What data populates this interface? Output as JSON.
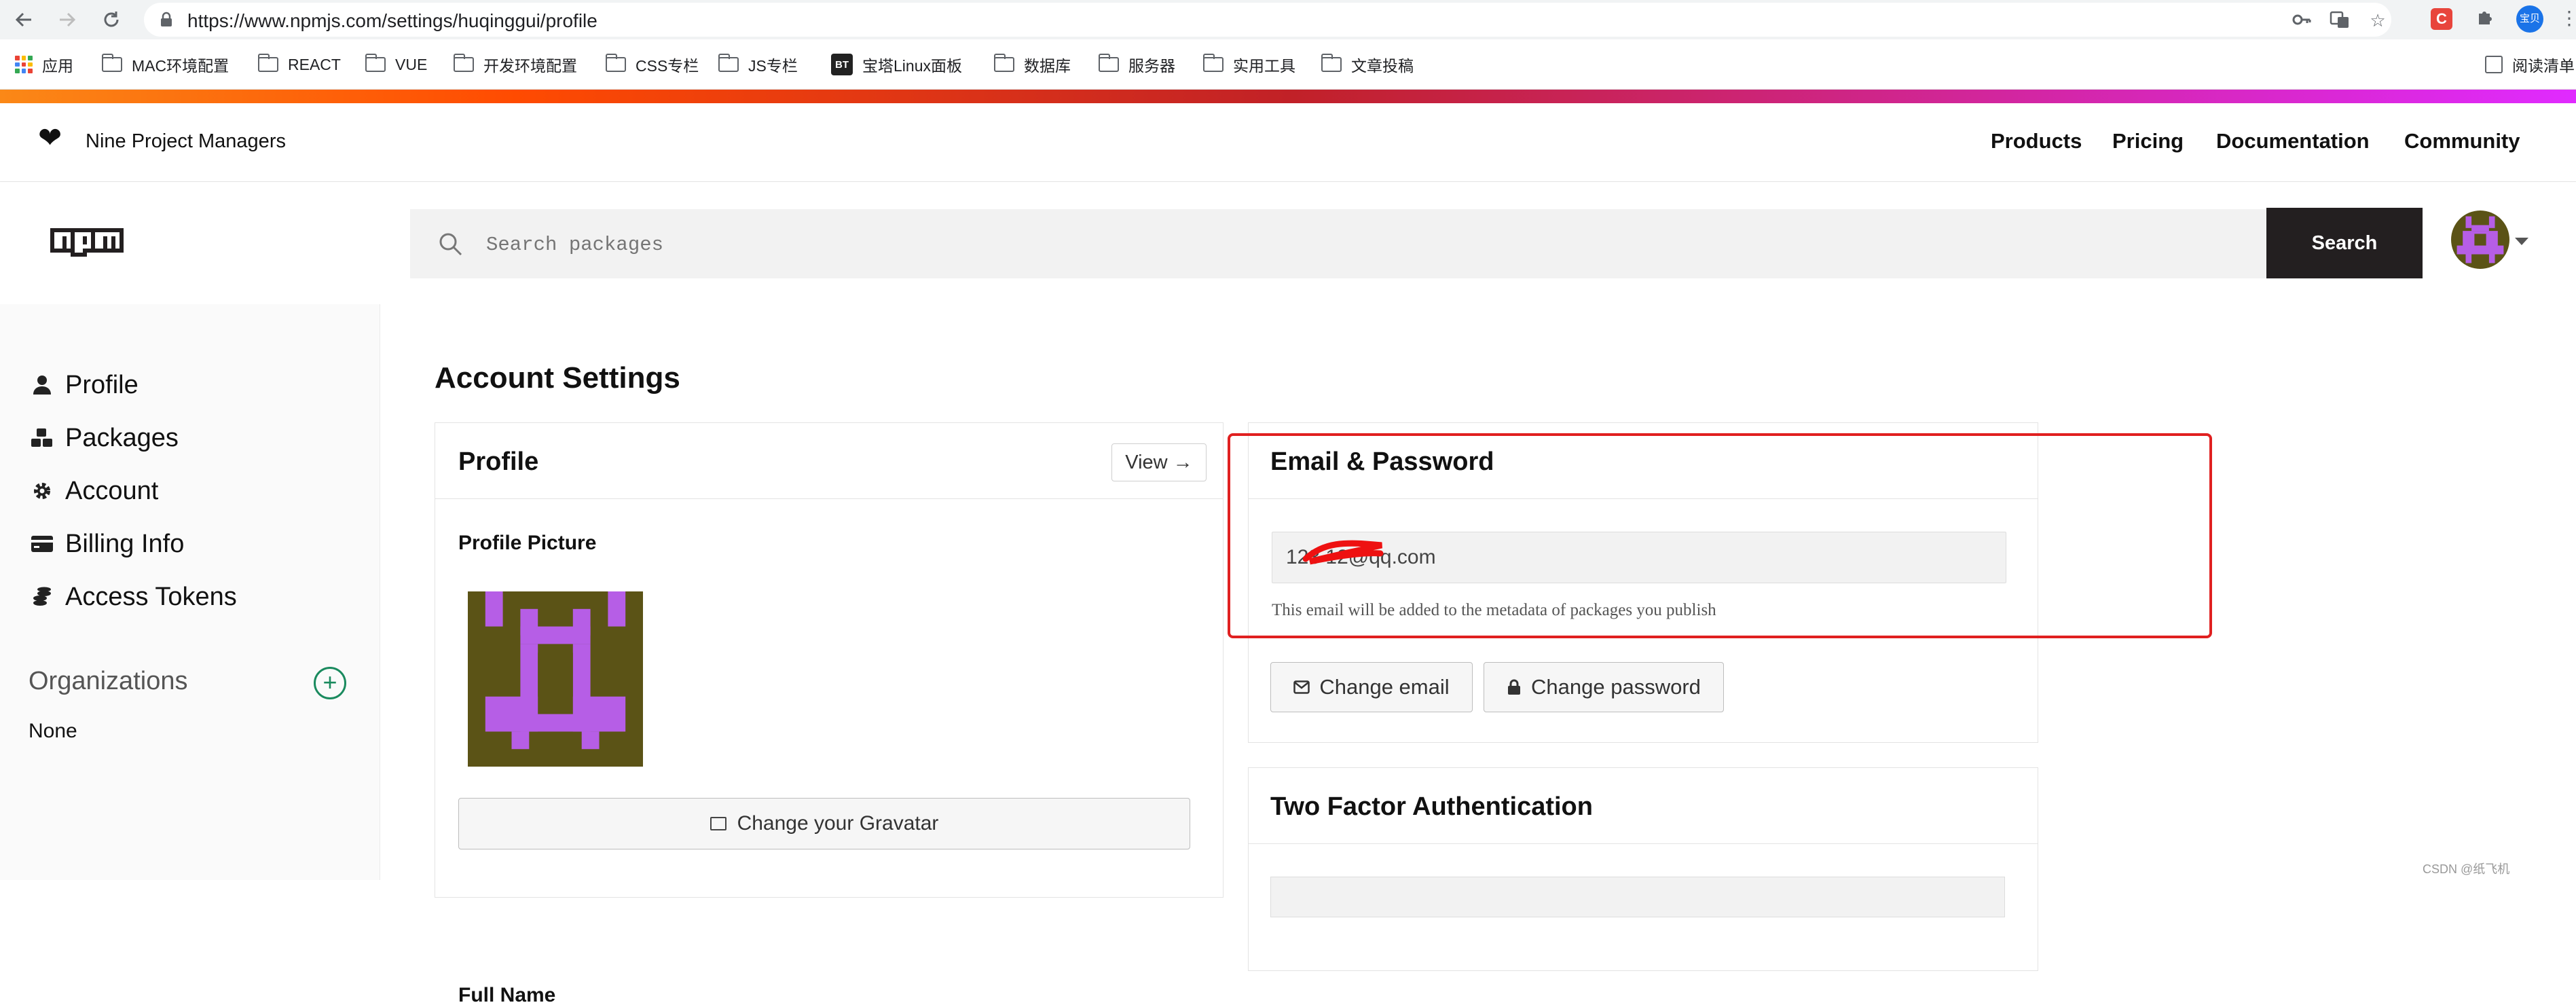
{
  "browser": {
    "url": "https://www.npmjs.com/settings/huqinggui/profile",
    "back_icon": "arrow-left-icon",
    "forward_icon": "arrow-right-icon",
    "reload_icon": "reload-icon",
    "extension_label": "C",
    "profile_label": "宝贝",
    "bookmarks": [
      "应用",
      "MAC环境配置",
      "REACT",
      "VUE",
      "开发环境配置",
      "CSS专栏",
      "JS专栏",
      "宝塔Linux面板",
      "数据库",
      "服务器",
      "实用工具",
      "文章投稿"
    ],
    "bookmark_bt_badge": "BT",
    "reading_list": "阅读清单"
  },
  "header": {
    "brand": "Nine Project Managers",
    "nav": [
      "Products",
      "Pricing",
      "Documentation",
      "Community"
    ]
  },
  "search": {
    "placeholder": "Search packages",
    "button": "Search"
  },
  "sidebar": {
    "items": [
      {
        "label": "Profile",
        "icon": "user-icon"
      },
      {
        "label": "Packages",
        "icon": "packages-icon"
      },
      {
        "label": "Account",
        "icon": "gear-icon"
      },
      {
        "label": "Billing Info",
        "icon": "credit-card-icon"
      },
      {
        "label": "Access Tokens",
        "icon": "coins-icon"
      }
    ],
    "organizations_title": "Organizations",
    "organizations_add": "+",
    "organizations_value": "None"
  },
  "main": {
    "title": "Account Settings",
    "profile_card": {
      "title": "Profile",
      "view_button": "View →",
      "picture_label": "Profile Picture",
      "gravatar_button": "Change your Gravatar",
      "full_name_label": "Full Name"
    },
    "email_card": {
      "title": "Email & Password",
      "email_value": "123        12@qq.com",
      "email_help": "This email will be added to the metadata of packages you publish",
      "change_email": "Change email",
      "change_password": "Change password"
    },
    "tfa_card": {
      "title": "Two Factor Authentication"
    }
  },
  "colors": {
    "avatar_bg": "#5b5316",
    "avatar_fg": "#b65ee6",
    "highlight": "#e02020",
    "search_button": "#231f20"
  },
  "watermark": "CSDN @纸飞机"
}
